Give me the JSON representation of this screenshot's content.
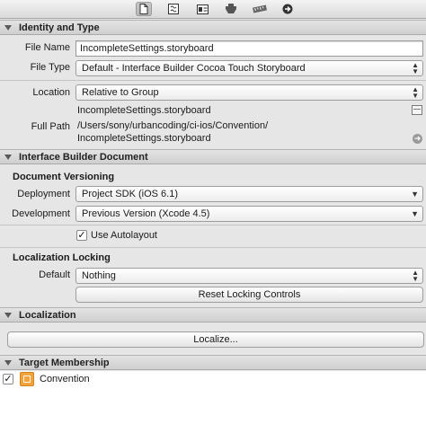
{
  "toolbar": {
    "icons": [
      "file-icon",
      "quick-help-icon",
      "identity-icon",
      "attributes-icon",
      "size-icon",
      "connections-icon"
    ]
  },
  "identity": {
    "header": "Identity and Type",
    "file_name_label": "File Name",
    "file_name_value": "IncompleteSettings.storyboard",
    "file_type_label": "File Type",
    "file_type_value": "Default - Interface Builder Cocoa Touch Storyboard",
    "location_label": "Location",
    "location_value": "Relative to Group",
    "location_file": "IncompleteSettings.storyboard",
    "full_path_label": "Full Path",
    "full_path_line1": "/Users/sony/urbancoding/ci-ios/Convention/",
    "full_path_line2": "IncompleteSettings.storyboard"
  },
  "ib_document": {
    "header": "Interface Builder Document",
    "versioning_title": "Document Versioning",
    "deployment_label": "Deployment",
    "deployment_value": "Project SDK (iOS 6.1)",
    "development_label": "Development",
    "development_value": "Previous Version (Xcode 4.5)",
    "autolayout_label": "Use Autolayout",
    "autolayout_checked": true,
    "locking_title": "Localization Locking",
    "default_label": "Default",
    "default_value": "Nothing",
    "reset_button": "Reset Locking Controls"
  },
  "localization": {
    "header": "Localization",
    "localize_button": "Localize..."
  },
  "target_membership": {
    "header": "Target Membership",
    "targets": [
      {
        "name": "Convention",
        "checked": true,
        "icon_color": "#f2a33a"
      }
    ]
  }
}
